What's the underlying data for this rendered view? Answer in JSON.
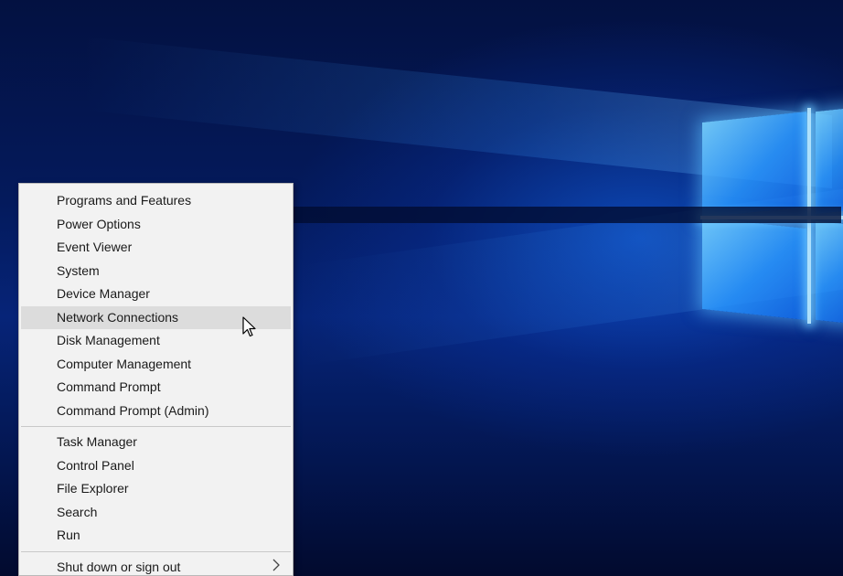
{
  "menu": {
    "group1": [
      {
        "label": "Programs and Features"
      },
      {
        "label": "Power Options"
      },
      {
        "label": "Event Viewer"
      },
      {
        "label": "System"
      },
      {
        "label": "Device Manager"
      },
      {
        "label": "Network Connections",
        "highlighted": true
      },
      {
        "label": "Disk Management"
      },
      {
        "label": "Computer Management"
      },
      {
        "label": "Command Prompt"
      },
      {
        "label": "Command Prompt (Admin)"
      }
    ],
    "group2": [
      {
        "label": "Task Manager"
      },
      {
        "label": "Control Panel"
      },
      {
        "label": "File Explorer"
      },
      {
        "label": "Search"
      },
      {
        "label": "Run"
      }
    ],
    "group3": [
      {
        "label": "Shut down or sign out",
        "submenu_icon": "chevron-right-icon"
      }
    ]
  },
  "colors": {
    "menu_background": "#f2f2f2",
    "hover_background": "#dcdcdc",
    "desktop_blue": "#062478",
    "glow_blue": "#3ca0ff"
  }
}
